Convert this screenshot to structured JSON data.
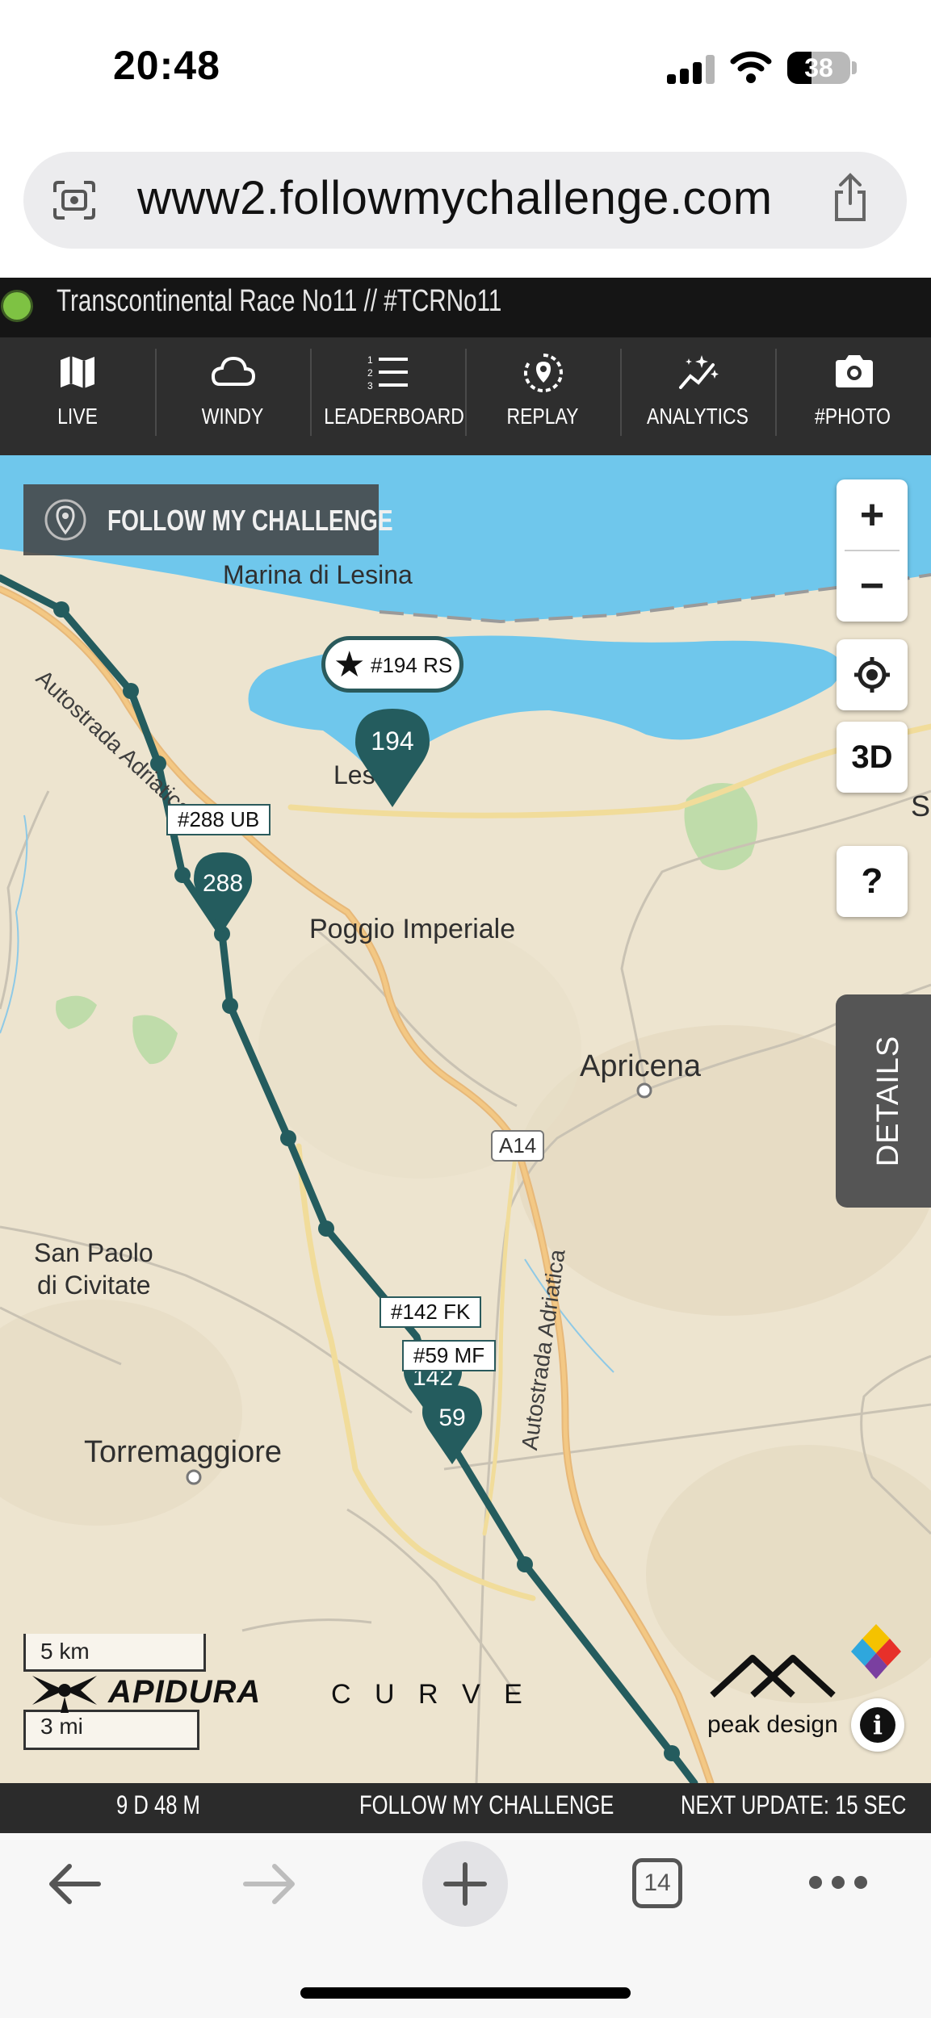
{
  "status_bar": {
    "time": "20:48",
    "battery": "38"
  },
  "browser": {
    "url": "www2.followmychallenge.com",
    "tab_count": "14"
  },
  "app": {
    "title": "Transcontinental Race No11 // #TCRNo11"
  },
  "nav": [
    {
      "label": "LIVE",
      "icon": "map-icon"
    },
    {
      "label": "WINDY",
      "icon": "cloud-icon"
    },
    {
      "label": "LEADERBOARD",
      "icon": "list-icon"
    },
    {
      "label": "REPLAY",
      "icon": "replay-icon"
    },
    {
      "label": "ANALYTICS",
      "icon": "sparkles-icon"
    },
    {
      "label": "#PHOTO",
      "icon": "camera-icon"
    }
  ],
  "map": {
    "logo": "FOLLOW MY CHALLENGE",
    "places": {
      "marina": "Marina di Lesina",
      "lesina": "Les",
      "poggio": "Poggio Imperiale",
      "apricena": "Apricena",
      "san_paolo_1": "San Paolo",
      "san_paolo_2": "di Civitate",
      "torremaggiore": "Torremaggiore",
      "edge_s": "S"
    },
    "roads": {
      "adriatica_1": "Autostrada Adriatica",
      "adriatica_2": "Autostrada Adriatica",
      "a14": "A14"
    },
    "controls": {
      "zoom_in": "+",
      "zoom_out": "−",
      "view_3d": "3D",
      "help": "?"
    },
    "details_label": "DETAILS",
    "riders": [
      {
        "number": "194",
        "tag": "#194 RS",
        "starred": true
      },
      {
        "number": "288",
        "tag": "#288 UB"
      },
      {
        "number": "142",
        "tag": "#142 FK"
      },
      {
        "number": "59",
        "tag": "#59 MF"
      }
    ],
    "scale": {
      "km": "5 km",
      "mi": "3 mi"
    },
    "sponsors": {
      "apidura": "APIDURA",
      "curve": "C U R V E",
      "peak": "peak design"
    },
    "colors": {
      "route": "#245c5e",
      "water": "#6fc7ec",
      "land": "#ede4cf"
    }
  },
  "footer": {
    "left": "9 D 48 M",
    "center": "FOLLOW MY CHALLENGE",
    "right": "NEXT UPDATE: 15 SEC"
  }
}
